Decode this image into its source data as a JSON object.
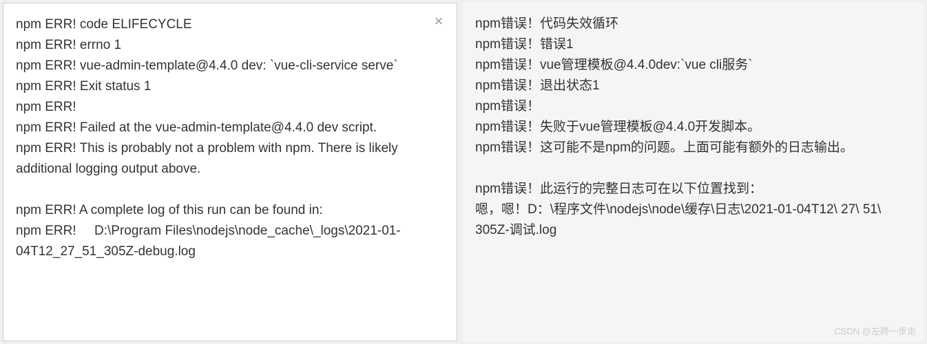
{
  "left_panel": {
    "lines": [
      "npm ERR! code ELIFECYCLE",
      "npm ERR! errno 1",
      "npm ERR! vue-admin-template@4.4.0 dev: `vue-cli-service serve`",
      "npm ERR! Exit status 1",
      "npm ERR!",
      "npm ERR! Failed at the vue-admin-template@4.4.0 dev script.",
      "npm ERR! This is probably not a problem with npm. There is likely additional logging output above.",
      "",
      "npm ERR! A complete log of this run can be found in:",
      "npm ERR!     D:\\Program Files\\nodejs\\node_cache\\_logs\\2021-01-04T12_27_51_305Z-debug.log"
    ]
  },
  "right_panel": {
    "lines": [
      "npm错误！代码失效循环",
      "npm错误！错误1",
      "npm错误！vue管理模板@4.4.0dev:`vue cli服务`",
      "npm错误！退出状态1",
      "npm错误！",
      "npm错误！失败于vue管理模板@4.4.0开发脚本。",
      "npm错误！这可能不是npm的问题。上面可能有额外的日志输出。",
      "",
      "npm错误！此运行的完整日志可在以下位置找到：",
      "嗯，嗯！D：\\程序文件\\nodejs\\node\\缓存\\日志\\2021-01-04T12\\ 27\\ 51\\ 305Z-调试.log"
    ]
  },
  "close_icon": "×",
  "watermark": "CSDN @左跨一步走"
}
